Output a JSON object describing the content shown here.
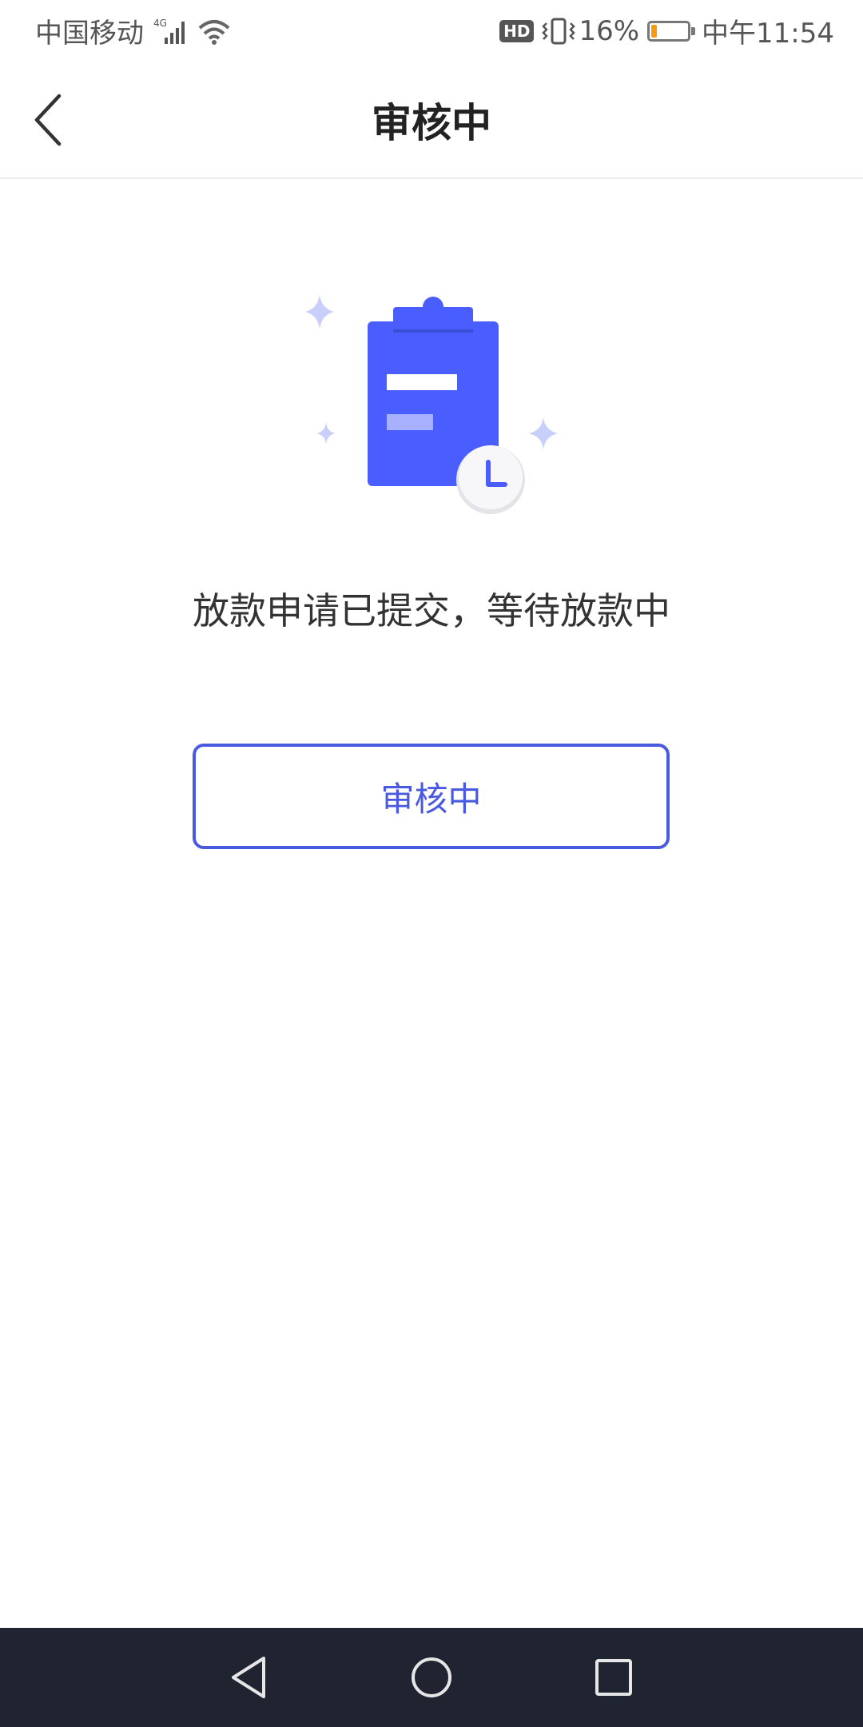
{
  "status_bar": {
    "carrier": "中国移动",
    "network": "4G",
    "hd": "HD",
    "battery_percent": "16%",
    "battery_level": 0.16,
    "time": "中午11:54"
  },
  "header": {
    "title": "审核中"
  },
  "main": {
    "message": "放款申请已提交，等待放款中",
    "button_label": "审核中"
  },
  "colors": {
    "accent": "#4a5ae0",
    "illustration_blue": "#4a5eff",
    "sparkle": "#c9cffb",
    "nav_bar": "#1f2430",
    "battery_fill": "#f39c12"
  },
  "icons": {
    "back": "chevron-left-icon",
    "clipboard": "clipboard-icon",
    "clock": "clock-icon",
    "nav_back": "triangle-back-icon",
    "nav_home": "circle-home-icon",
    "nav_recent": "square-recent-icon"
  }
}
